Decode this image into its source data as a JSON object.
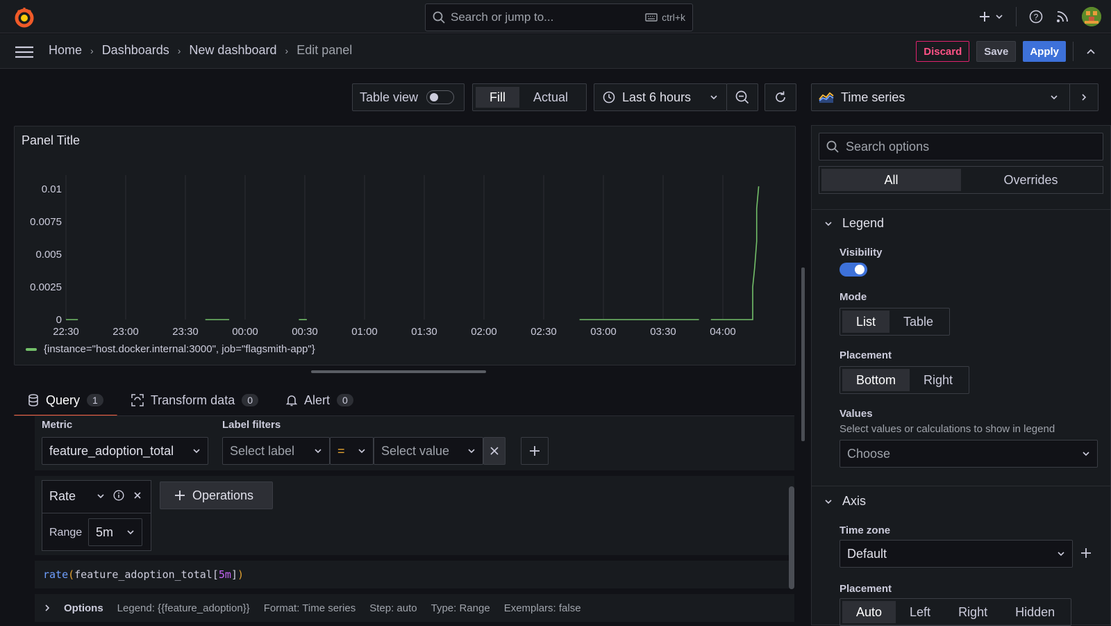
{
  "topbar": {
    "search_placeholder": "Search or jump to...",
    "shortcut": "ctrl+k"
  },
  "breadcrumb": {
    "items": [
      "Home",
      "Dashboards",
      "New dashboard"
    ],
    "current": "Edit panel"
  },
  "actions": {
    "discard": "Discard",
    "save": "Save",
    "apply": "Apply"
  },
  "toolbar": {
    "table_view": "Table view",
    "fill": "Fill",
    "actual": "Actual",
    "time_range": "Last 6 hours"
  },
  "panel": {
    "title": "Panel Title",
    "legend_label": "{instance=\"host.docker.internal:3000\", job=\"flagsmith-app\"}"
  },
  "chart_data": {
    "type": "line",
    "x_ticks": [
      "22:30",
      "23:00",
      "23:30",
      "00:00",
      "00:30",
      "01:00",
      "01:30",
      "02:00",
      "02:30",
      "03:00",
      "03:30",
      "04:00"
    ],
    "y_ticks": [
      "0.01",
      "0.0075",
      "0.005",
      "0.0025",
      "0"
    ],
    "ylim": [
      0,
      0.01
    ],
    "series": [
      {
        "name": "{instance=\"host.docker.internal:3000\", job=\"flagsmith-app\"}",
        "color": "#73bf69",
        "segments": [
          [
            [
              "22:30",
              0
            ],
            [
              "22:36",
              0
            ]
          ],
          [
            [
              "23:40",
              0
            ],
            [
              "23:52",
              0
            ]
          ],
          [
            [
              "00:27",
              0
            ],
            [
              "00:31",
              0
            ]
          ],
          [
            [
              "02:48",
              0
            ],
            [
              "03:48",
              0
            ]
          ],
          [
            [
              "03:54",
              0
            ],
            [
              "04:15",
              0
            ],
            [
              "04:15",
              0.0025
            ],
            [
              "04:16",
              0.004
            ],
            [
              "04:17",
              0.006
            ],
            [
              "04:17",
              0.0085
            ],
            [
              "04:18",
              0.0102
            ]
          ]
        ]
      }
    ]
  },
  "query_tabs": [
    {
      "label": "Query",
      "count": "1"
    },
    {
      "label": "Transform data",
      "count": "0"
    },
    {
      "label": "Alert",
      "count": "0"
    }
  ],
  "query": {
    "metric_label": "Metric",
    "metric_value": "feature_adoption_total",
    "label_filters_label": "Label filters",
    "select_label": "Select label",
    "operator": "=",
    "select_value": "Select value",
    "operation_name": "Rate",
    "range_label": "Range",
    "range_value": "5m",
    "operations_button": "Operations",
    "code_fn": "rate",
    "code_metric": "feature_adoption_total",
    "code_range": "5m",
    "options_head": "Options",
    "opt_legend": "Legend: {{feature_adoption}}",
    "opt_format": "Format: Time series",
    "opt_step": "Step: auto",
    "opt_type": "Type: Range",
    "opt_exemplars": "Exemplars: false"
  },
  "sidebar": {
    "viz": "Time series",
    "search_placeholder": "Search options",
    "tab_all": "All",
    "tab_overrides": "Overrides",
    "legend_section": "Legend",
    "visibility": "Visibility",
    "mode": "Mode",
    "mode_list": "List",
    "mode_table": "Table",
    "placement": "Placement",
    "place_bottom": "Bottom",
    "place_right": "Right",
    "values": "Values",
    "values_desc": "Select values or calculations to show in legend",
    "values_choose": "Choose",
    "axis_section": "Axis",
    "time_zone": "Time zone",
    "time_zone_value": "Default",
    "axis_placement": "Placement",
    "ap_auto": "Auto",
    "ap_left": "Left",
    "ap_right": "Right",
    "ap_hidden": "Hidden"
  },
  "colors": {
    "accent": "#3d71d9",
    "danger": "#ff5286",
    "series": "#73bf69",
    "tab_underline": "#f55f3e"
  }
}
